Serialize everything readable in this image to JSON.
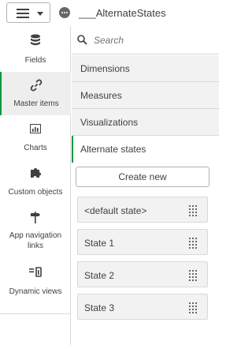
{
  "header": {
    "app_title": "___AlternateStates",
    "menu_icon": "hamburger-icon",
    "app_icon": "more-options-icon"
  },
  "nav": {
    "items": [
      {
        "label": "Fields",
        "icon": "database-icon",
        "active": false
      },
      {
        "label": "Master items",
        "icon": "link-icon",
        "active": true
      },
      {
        "label": "Charts",
        "icon": "bar-chart-icon",
        "active": false
      },
      {
        "label": "Custom objects",
        "icon": "puzzle-icon",
        "active": false
      },
      {
        "label": "App navigation links",
        "icon": "signpost-icon",
        "active": false
      },
      {
        "label": "Dynamic views",
        "icon": "dynamic-views-icon",
        "active": false
      }
    ]
  },
  "search": {
    "placeholder": "Search"
  },
  "sections": [
    {
      "label": "Dimensions",
      "active": false
    },
    {
      "label": "Measures",
      "active": false
    },
    {
      "label": "Visualizations",
      "active": false
    },
    {
      "label": "Alternate states",
      "active": true
    }
  ],
  "create_new_label": "Create new",
  "states": [
    {
      "label": "<default state>"
    },
    {
      "label": "State 1"
    },
    {
      "label": "State 2"
    },
    {
      "label": "State 3"
    }
  ],
  "colors": {
    "accent": "#009845",
    "panel": "#f2f2f2",
    "border": "#d9d9d9",
    "text": "#404040"
  }
}
